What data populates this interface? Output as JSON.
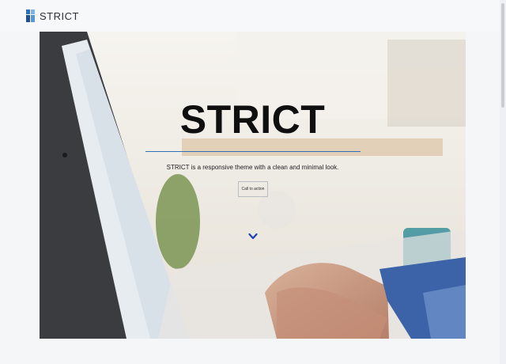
{
  "brand": {
    "name": "STRICT"
  },
  "hero": {
    "title": "STRICT",
    "subtitle": "STRICT is a responsive theme with a clean and minimal look.",
    "cta_label": "Call to action"
  },
  "icons": {
    "logo": "strict-logo-icon",
    "scroll_down": "chevron-down-icon"
  },
  "colors": {
    "accent": "#2f6fb8",
    "title": "#0f0f10",
    "topbar_bg": "#f7f8fa"
  }
}
